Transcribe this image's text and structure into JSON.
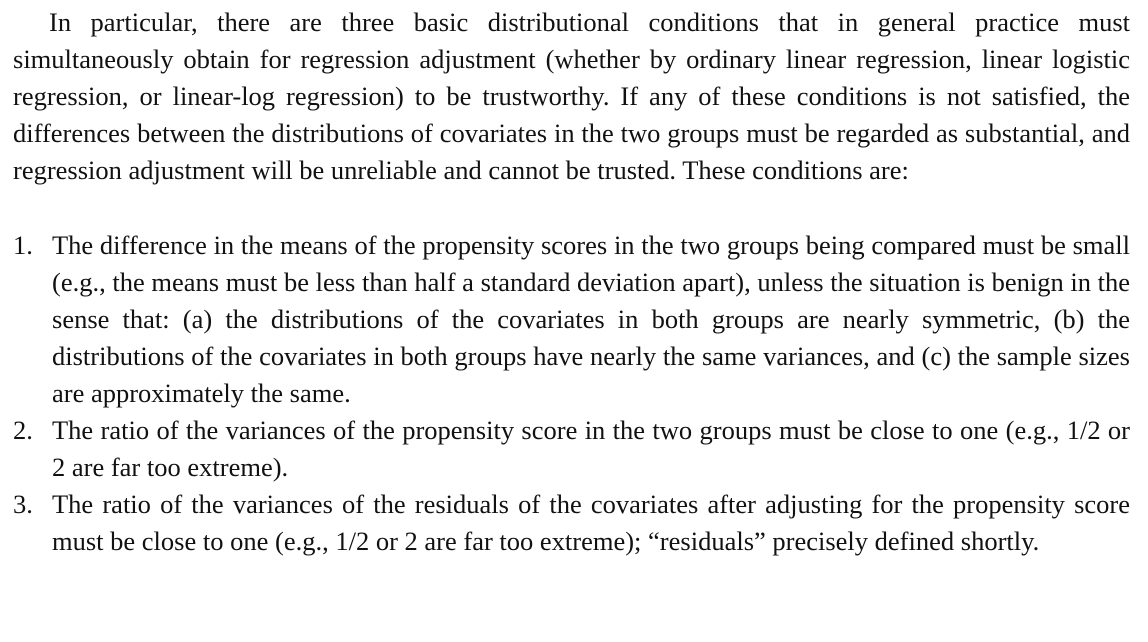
{
  "intro_paragraph": "In particular, there are three basic distributional conditions that in general practice must simultaneously obtain for regression adjustment (whether by ordinary linear regression, linear logistic regression, or linear-log regression) to be trustworthy. If any of these conditions is not satisfied, the differences between the distributions of covariates in the two groups must be regarded as substantial, and regression adjustment will be unreliable and cannot be trusted. These conditions are:",
  "conditions": [
    {
      "number": "1.",
      "text": "The difference in the means of the propensity scores in the two groups being compared must be small (e.g., the means must be less than half a standard deviation apart), unless the situation is benign in the sense that: (a) the distributions of the covariates in both groups are nearly symmetric, (b) the distributions of the covariates in both groups have nearly the same variances, and (c) the sample sizes are approximately the same."
    },
    {
      "number": "2.",
      "text": "The ratio of the variances of the propensity score in the two groups must be close to one (e.g., 1/2 or 2 are far too extreme)."
    },
    {
      "number": "3.",
      "text": "The ratio of the variances of the residuals of the covariates after adjusting for the propensity score must be close to one (e.g., 1/2 or 2 are far too extreme); “residuals” precisely defined shortly."
    }
  ]
}
